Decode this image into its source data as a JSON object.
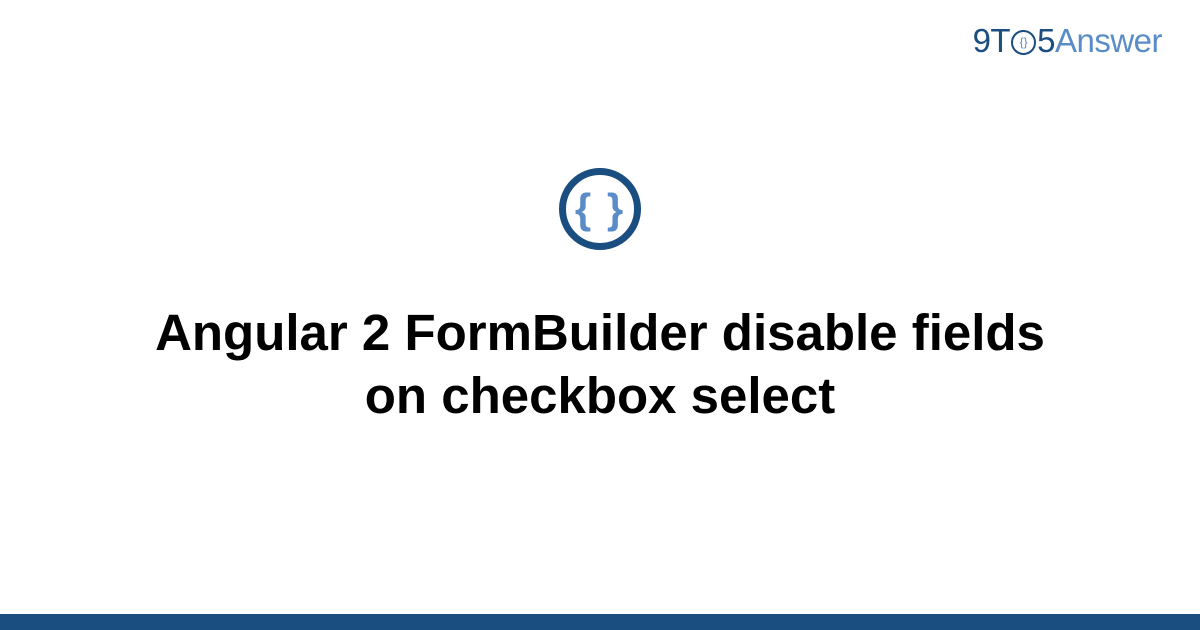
{
  "logo": {
    "part1": "9T",
    "o_inner": "{}",
    "part2": "5",
    "part3": "Answer"
  },
  "icon": {
    "braces": "{ }"
  },
  "title": "Angular 2 FormBuilder disable fields on checkbox select"
}
